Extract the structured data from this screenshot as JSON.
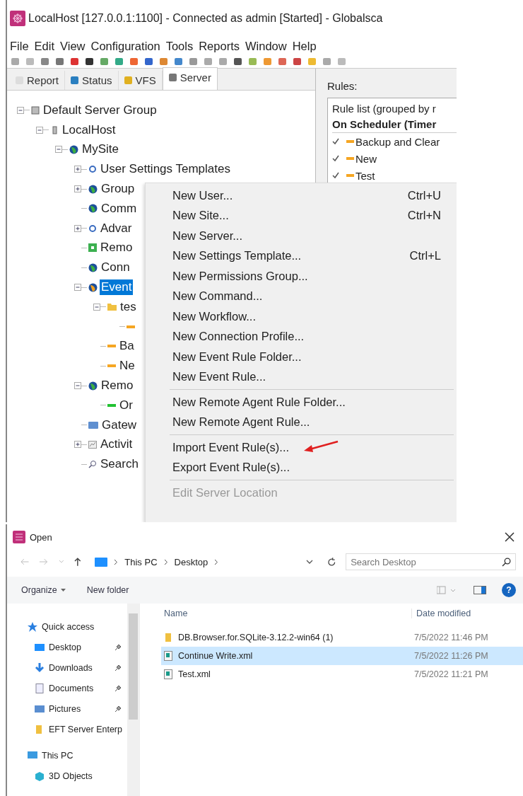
{
  "window": {
    "title": "LocalHost [127.0.0.1:1100] - Connected as admin [Started] - Globalsca"
  },
  "menu_bar": [
    "File",
    "Edit",
    "View",
    "Configuration",
    "Tools",
    "Reports",
    "Window",
    "Help"
  ],
  "tabs": [
    {
      "label": "Report",
      "kind": "report",
      "selected": false
    },
    {
      "label": "Status",
      "kind": "status",
      "selected": false
    },
    {
      "label": "VFS",
      "kind": "vfs",
      "selected": false
    },
    {
      "label": "Server",
      "kind": "server",
      "selected": true
    }
  ],
  "tree": [
    {
      "label": "Default Server Group",
      "kind": "group",
      "expanded": true,
      "selected": false,
      "children": [
        {
          "label": "LocalHost",
          "kind": "server",
          "expanded": true,
          "selected": false,
          "children": [
            {
              "label": "MySite",
              "kind": "globe",
              "expanded": true,
              "selected": false,
              "children": [
                {
                  "label": "User Settings Templates",
                  "kind": "template",
                  "expanded": false,
                  "selected": false
                },
                {
                  "label": "Group",
                  "kind": "globe",
                  "expanded": false,
                  "selected": false
                },
                {
                  "label": "Comm",
                  "kind": "globe",
                  "selected": false
                },
                {
                  "label": "Advar",
                  "kind": "settings",
                  "expanded": false,
                  "selected": false
                },
                {
                  "label": "Remo",
                  "kind": "square",
                  "selected": false
                },
                {
                  "label": "Conn",
                  "kind": "globe",
                  "selected": false
                },
                {
                  "label": "Event",
                  "kind": "event",
                  "expanded": true,
                  "selected": true,
                  "children": [
                    {
                      "label": "tes",
                      "kind": "folder",
                      "expanded": true,
                      "selected": false,
                      "children": [
                        {
                          "kind": "rule",
                          "color": "#f5a623"
                        }
                      ]
                    },
                    {
                      "label": "Ba",
                      "kind": "rule",
                      "color": "#f5a623",
                      "selected": false
                    },
                    {
                      "label": "Ne",
                      "kind": "rule",
                      "color": "#f5a623",
                      "selected": false
                    }
                  ]
                },
                {
                  "label": "Remo",
                  "kind": "globe",
                  "expanded": true,
                  "selected": false,
                  "children": [
                    {
                      "label": "Or",
                      "kind": "rule",
                      "color": "#22c232",
                      "selected": false
                    }
                  ]
                },
                {
                  "label": "Gatew",
                  "kind": "gateway",
                  "selected": false
                },
                {
                  "label": "Activit",
                  "kind": "activity",
                  "expanded": false,
                  "selected": false
                },
                {
                  "label": "Search",
                  "kind": "search",
                  "selected": false
                }
              ]
            }
          ]
        }
      ]
    }
  ],
  "rules_panel": {
    "label": "Rules:",
    "list_header": "Rule list (grouped by r",
    "group": "On Scheduler (Timer",
    "rules": [
      {
        "name": "Backup and Clear",
        "checked": true,
        "color": "#f5a623"
      },
      {
        "name": "New",
        "checked": true,
        "color": "#f5a623"
      },
      {
        "name": "Test",
        "checked": true,
        "color": "#f5a623"
      }
    ]
  },
  "context_menu": {
    "groups": [
      [
        {
          "label": "New User...",
          "shortcut": "Ctrl+U",
          "disabled": false
        },
        {
          "label": "New Site...",
          "shortcut": "Ctrl+N",
          "disabled": false
        },
        {
          "label": "New Server...",
          "disabled": false
        },
        {
          "label": "New Settings Template...",
          "shortcut": "Ctrl+L",
          "disabled": false
        },
        {
          "label": "New Permissions Group...",
          "disabled": false
        },
        {
          "label": "New Command...",
          "disabled": false
        },
        {
          "label": "New Workflow...",
          "disabled": false
        },
        {
          "label": "New Connection Profile...",
          "disabled": false
        },
        {
          "label": "New Event Rule Folder...",
          "disabled": false
        },
        {
          "label": "New Event Rule...",
          "disabled": false
        }
      ],
      [
        {
          "label": "New Remote Agent Rule Folder...",
          "disabled": false
        },
        {
          "label": "New Remote Agent Rule...",
          "disabled": false
        }
      ],
      [
        {
          "label": "Import Event Rule(s)...",
          "disabled": false
        },
        {
          "label": "Export Event Rule(s)...",
          "disabled": false
        }
      ],
      [
        {
          "label": "Edit Server Location",
          "disabled": true
        }
      ]
    ]
  },
  "open_dialog": {
    "title": "Open",
    "address": {
      "path": [
        "This PC",
        "Desktop"
      ]
    },
    "search": {
      "placeholder": "Search Desktop"
    },
    "toolbar": {
      "organize": "Organize",
      "new_folder": "New folder",
      "help": "?"
    },
    "navigation": [
      {
        "label": "Quick access",
        "kind": "star",
        "children": [
          {
            "label": "Desktop",
            "kind": "desktop",
            "pinned": true
          },
          {
            "label": "Downloads",
            "kind": "download",
            "pinned": true
          },
          {
            "label": "Documents",
            "kind": "document",
            "pinned": true
          },
          {
            "label": "Pictures",
            "kind": "picture",
            "pinned": true
          },
          {
            "label": "EFT Server Enterp",
            "kind": "folder",
            "pinned": false
          }
        ]
      },
      {
        "label": "This PC",
        "kind": "pc",
        "children": [
          {
            "label": "3D Objects",
            "kind": "cube",
            "pinned": false
          }
        ]
      }
    ],
    "files": {
      "columns": [
        "Name",
        "Date modified"
      ],
      "rows": [
        {
          "name": "DB.Browser.for.SQLite-3.12.2-win64 (1)",
          "date": "7/5/2022 11:46 PM",
          "kind": "folder",
          "selected": false
        },
        {
          "name": "Continue Write.xml",
          "date": "7/5/2022 11:26 PM",
          "kind": "xml",
          "selected": true
        },
        {
          "name": "Test.xml",
          "date": "7/5/2022 11:21 PM",
          "kind": "xml",
          "selected": false
        }
      ]
    }
  }
}
